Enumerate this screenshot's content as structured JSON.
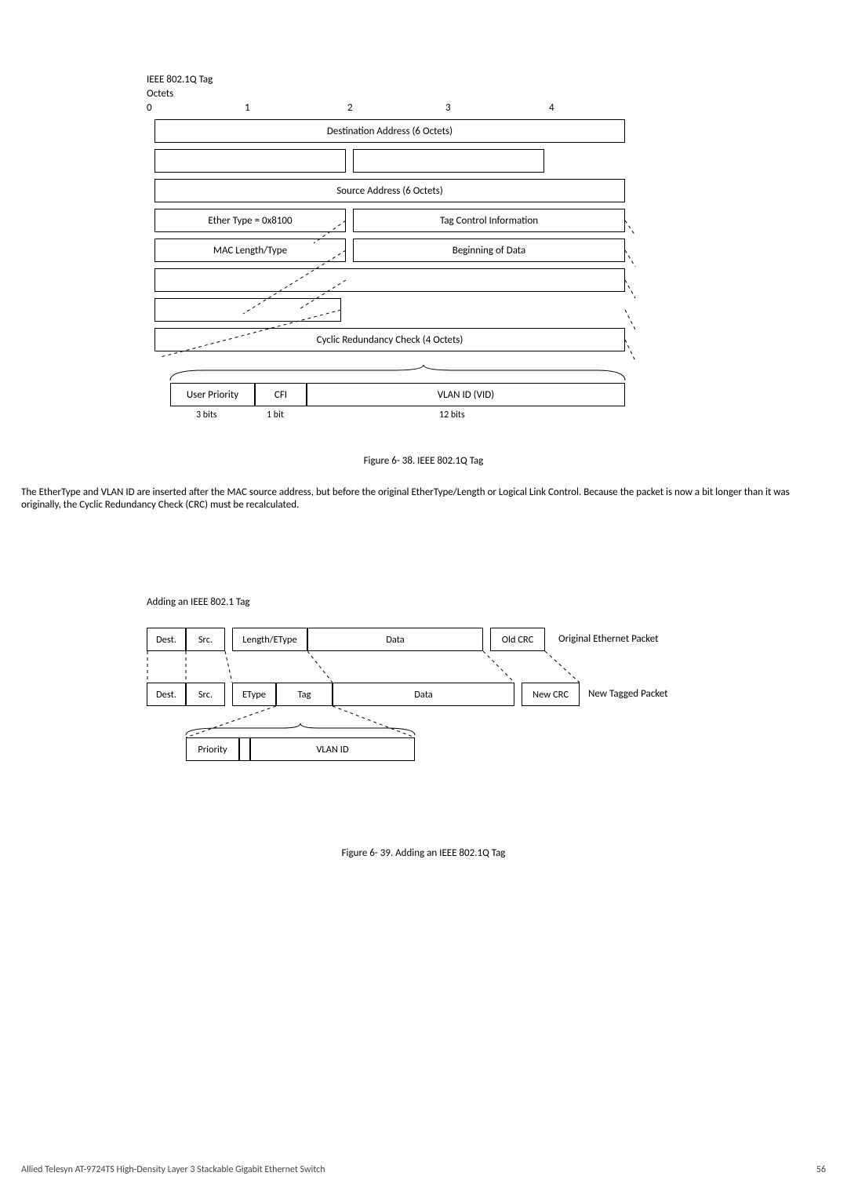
{
  "fig1": {
    "title": "IEEE 802.1Q Tag",
    "subtitle": "Octets",
    "scale": [
      "0",
      "1",
      "2",
      "3",
      "4"
    ],
    "rows": {
      "dest": "Destination Address (6 Octets)",
      "src": "Source Address (6 Octets)",
      "ether_type": "Ether Type = 0x8100",
      "tci": "Tag Control Information",
      "mac_len": "MAC Length/Type",
      "begin_data": "Beginning of Data",
      "crc": "Cyclic Redundancy Check (4 Octets)"
    },
    "detail": {
      "user_priority": "User Priority",
      "cfi": "CFI",
      "vid": "VLAN ID (VID)",
      "bits_up": "3 bits",
      "bits_cfi": "1 bit",
      "bits_vid": "12 bits"
    },
    "caption": "Figure 6- 38. IEEE 802.1Q Tag"
  },
  "paragraph": "The EtherType and VLAN ID are inserted after the MAC source address, but before the original EtherType/Length or Logical Link Control. Because the packet is now a bit longer than it was originally, the Cyclic Redundancy Check (CRC) must be recalculated.",
  "fig2": {
    "title": "Adding an IEEE 802.1 Tag",
    "original": {
      "dest": "Dest.",
      "src": "Src.",
      "len": "Length/EType",
      "data": "Data",
      "crc": "Old CRC",
      "label": "Original Ethernet Packet"
    },
    "tagged": {
      "dest": "Dest.",
      "src": "Src.",
      "etype": "EType",
      "tag": "Tag",
      "data": "Data",
      "crc": "New CRC",
      "label": "New Tagged Packet"
    },
    "breakdown": {
      "priority": "Priority",
      "vlan_id": "VLAN ID"
    },
    "caption": "Figure 6- 39. Adding an IEEE 802.1Q Tag"
  },
  "footer": {
    "left": "Allied Telesyn AT-9724TS High-Density Layer 3 Stackable Gigabit Ethernet Switch",
    "page": "56"
  }
}
